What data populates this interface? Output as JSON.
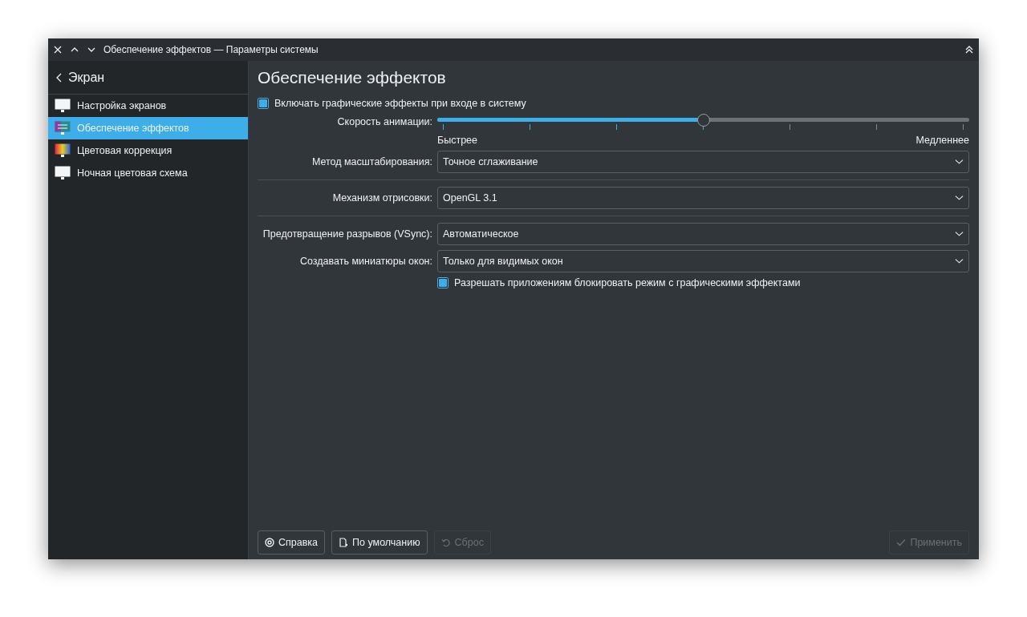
{
  "window": {
    "title": "Обеспечение эффектов — Параметры системы"
  },
  "sidebar": {
    "back_label": "Экран",
    "items": [
      {
        "label": "Настройка экранов",
        "selected": false
      },
      {
        "label": "Обеспечение эффектов",
        "selected": true
      },
      {
        "label": "Цветовая коррекция",
        "selected": false
      },
      {
        "label": "Ночная цветовая схема",
        "selected": false
      }
    ]
  },
  "page": {
    "title": "Обеспечение эффектов",
    "rows": [
      {
        "kind": "checkbox",
        "label": "Включать графические эффекты при входе в систему",
        "checked": true
      },
      {
        "kind": "slider",
        "label": "Скорость анимации:",
        "level": 0.5,
        "min_label": "Быстрее",
        "max_label": "Медленнее"
      },
      {
        "kind": "combo",
        "label": "Метод масштабирования:",
        "value": "Точное сглаживание"
      },
      {
        "kind": "separator"
      },
      {
        "kind": "combo",
        "label": "Механизм отрисовки:",
        "value": "OpenGL 3.1"
      },
      {
        "kind": "separator"
      },
      {
        "kind": "combo",
        "label": "Предотвращение разрывов (VSync):",
        "value": "Автоматическое"
      },
      {
        "kind": "combo",
        "label": "Создавать миниатюры окон:",
        "value": "Только для видимых окон"
      },
      {
        "kind": "checkbox",
        "label": "Разрешать приложениям блокировать режим с графическими эффектами",
        "checked": true
      }
    ]
  },
  "buttons": [
    {
      "label": "Справка",
      "disabled": false
    },
    {
      "label": "По умолчанию",
      "disabled": false
    },
    {
      "label": "Сброс",
      "disabled": true
    },
    {
      "label": "Применить",
      "disabled": true
    }
  ]
}
